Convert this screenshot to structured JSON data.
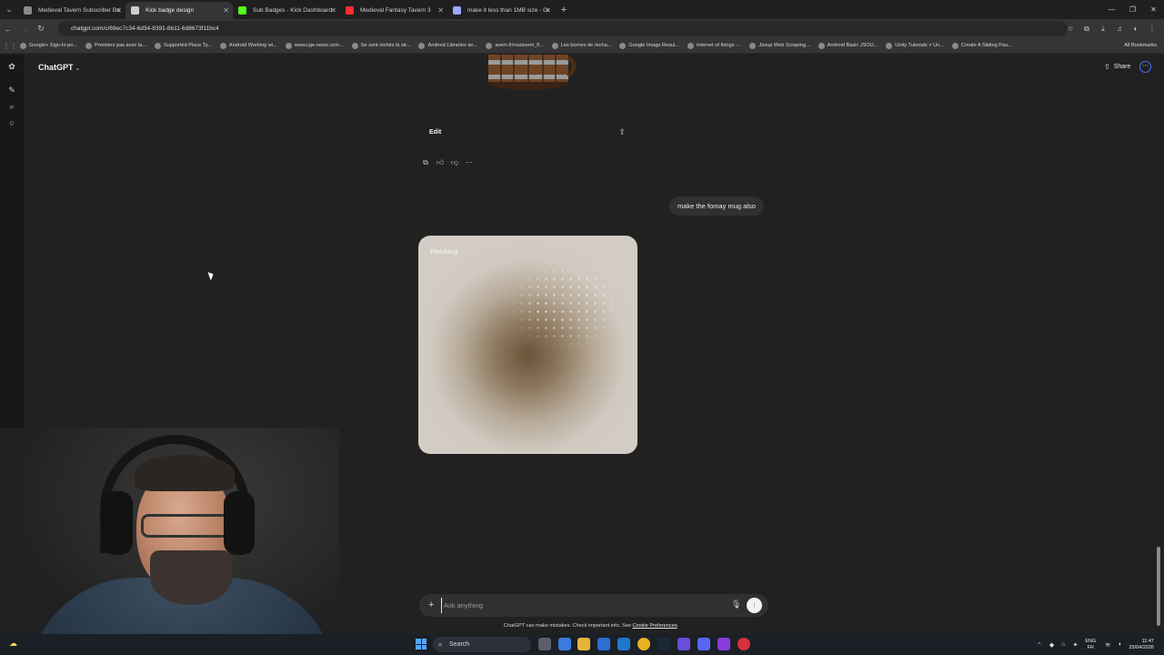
{
  "browser": {
    "tabs": [
      {
        "title": "Medieval Tavern Subscriber Ba",
        "favicon_color": "#8a8a8a",
        "active": false
      },
      {
        "title": "Kick badge design",
        "favicon_color": "#cfcfcf",
        "active": true
      },
      {
        "title": "Sub Badges - Kick Dashboard",
        "favicon_color": "#53fc18",
        "active": false
      },
      {
        "title": "Medieval Fantasy Tavern 3",
        "favicon_color": "#ff2d2d",
        "active": false
      },
      {
        "title": "make it less than 1MB size - Gr",
        "favicon_color": "#9aa7ff",
        "active": false
      }
    ],
    "url": "chatgpt.com/c/69ec7c34-6d34-8391-8b11-6d8673f11bc4",
    "bookmarks": [
      "Google+ Sign-In po...",
      "Premiers pas avec la...",
      "Supported Place Ty...",
      "Android Working wi...",
      "www.cge-news.com...",
      "Se sont nichés là str...",
      "Android Libraries an...",
      "avem.fr/rss/avem_fl...",
      "Les bornes de recha...",
      "Google Image Resul...",
      "internet of things -...",
      "Jsoup Web Scraping...",
      "Android Basic JSOU...",
      "Unity Tutorials > Un...",
      "Create A Sliding Pau..."
    ],
    "all_bookmarks": "All Bookmarks"
  },
  "chat": {
    "model_label": "ChatGPT",
    "share_label": "Share",
    "edit_label": "Edit",
    "user_message": "make the fomay mug also",
    "generation_status": "Finishing",
    "composer_placeholder": "Ask anything",
    "disclaimer_text": "ChatGPT can make mistakes. Check important info. See",
    "disclaimer_link": "Cookie Preferences",
    "disclaimer_end": "."
  },
  "taskbar": {
    "search_label": "Search",
    "lang_top": "ENG",
    "lang_bottom": "FR",
    "time": "11:47",
    "date": "25/04/2026"
  },
  "colors": {
    "accent": "#4f6cff",
    "badge_red": "#d8323a"
  }
}
